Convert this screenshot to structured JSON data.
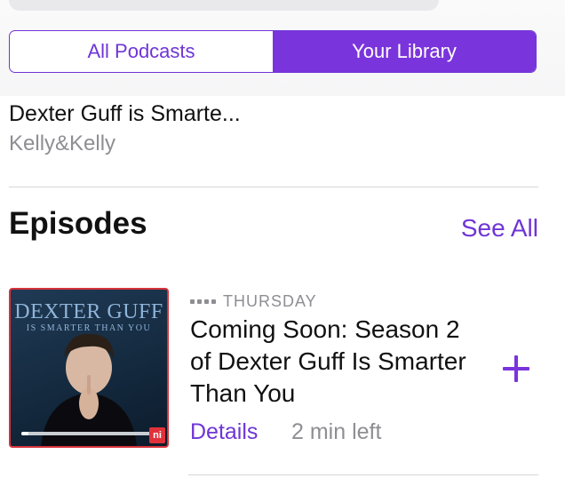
{
  "segmented": {
    "options": [
      "All Podcasts",
      "Your Library"
    ],
    "selected": "Your Library"
  },
  "podcast": {
    "title": "Dexter Guff is Smarte...",
    "author": "Kelly&Kelly"
  },
  "episodes": {
    "heading": "Episodes",
    "see_all": "See All",
    "items": [
      {
        "date": "THURSDAY",
        "title": "Coming Soon: Season 2 of Dexter Guff Is Smarter Than You",
        "details_label": "Details",
        "time_left": "2 min left",
        "progress_fraction": 0.05,
        "artwork": {
          "title": "DEXTER GUFF",
          "subtitle": "IS SMARTER THAN YOU",
          "badge": "ni"
        }
      }
    ]
  },
  "colors": {
    "accent": "#7a34dc",
    "secondary_text": "#8e8e93",
    "artwork_border": "#d6333b"
  },
  "icons": [
    "add-icon",
    "unplayed-dots-icon"
  ]
}
